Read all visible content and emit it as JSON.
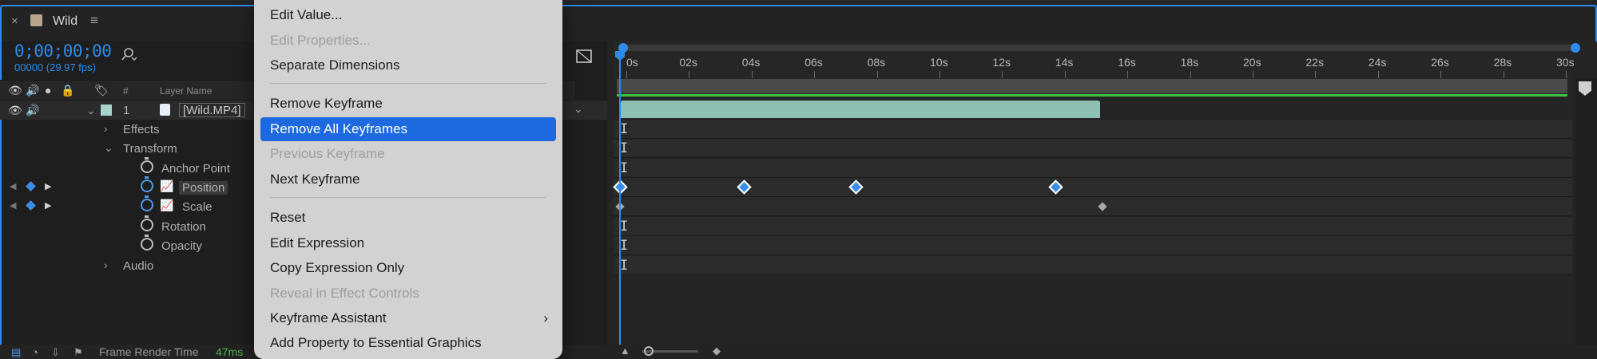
{
  "composition": {
    "title": "Wild",
    "close_glyph": "×",
    "menu_glyph": "≡"
  },
  "time": {
    "timecode": "0;00;00;00",
    "frame_info": "00000 (29.97 fps)"
  },
  "header": {
    "hash_label": "#",
    "layer_name_label": "Layer Name"
  },
  "layer": {
    "number": "1",
    "name": "[Wild.MP4]"
  },
  "properties": {
    "effects": "Effects",
    "transform": "Transform",
    "anchor_point": "Anchor Point",
    "position": "Position",
    "scale": "Scale",
    "rotation": "Rotation",
    "opacity": "Opacity",
    "audio": "Audio"
  },
  "ruler": {
    "labels": [
      "0s",
      "02s",
      "04s",
      "06s",
      "08s",
      "10s",
      "12s",
      "14s",
      "16s",
      "18s",
      "20s",
      "22s",
      "24s",
      "26s",
      "28s",
      "30s"
    ]
  },
  "status": {
    "label": "Frame Render Time",
    "value": "47ms"
  },
  "context_menu": {
    "items": [
      {
        "label": "Edit Value...",
        "state": "enabled"
      },
      {
        "label": "Edit Properties...",
        "state": "disabled"
      },
      {
        "label": "Separate Dimensions",
        "state": "enabled"
      },
      {
        "label": "Remove Keyframe",
        "state": "enabled"
      },
      {
        "label": "Remove All Keyframes",
        "state": "selected"
      },
      {
        "label": "Previous Keyframe",
        "state": "disabled"
      },
      {
        "label": "Next Keyframe",
        "state": "enabled"
      },
      {
        "label": "Reset",
        "state": "enabled"
      },
      {
        "label": "Edit Expression",
        "state": "enabled"
      },
      {
        "label": "Copy Expression Only",
        "state": "enabled"
      },
      {
        "label": "Reveal in Effect Controls",
        "state": "disabled"
      },
      {
        "label": "Keyframe Assistant",
        "state": "enabled",
        "submenu": true
      },
      {
        "label": "Add Property to Essential Graphics",
        "state": "enabled"
      }
    ]
  },
  "colors": {
    "accent": "#2d8ceb",
    "selection": "#1d6ae0",
    "clip": "#8ebfb3",
    "timecode": "#2d8ceb",
    "render_time": "#4bb04b"
  }
}
